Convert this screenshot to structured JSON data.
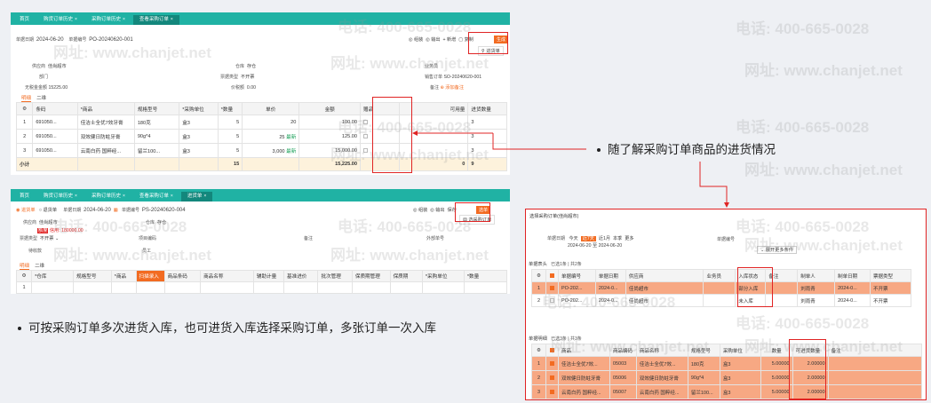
{
  "watermark": {
    "phone": "电话: 400-665-0028",
    "site": "网址: www.chanjet.net"
  },
  "top": {
    "tabs": [
      {
        "label": "首页"
      },
      {
        "label": "购货订单历史"
      },
      {
        "label": "采购订单历史"
      },
      {
        "label": "查看采购订单"
      }
    ],
    "doc_date_label": "单据日期",
    "doc_date": "2024-06-20",
    "doc_no_label": "单据编号",
    "doc_no": "PO-20240620-001",
    "toolbar": [
      "组装",
      "输出",
      "新增",
      "复制",
      "生成"
    ],
    "gen_menu": "进货单",
    "supplier_label": "供应商",
    "supplier": "佳尚超市",
    "dept_label": "部门",
    "dept": "",
    "pay_label": "无税金金额",
    "pay": "15225.00",
    "warehouse_label": "仓库",
    "warehouse": "存仓",
    "invoice_label": "票据类型",
    "invoice": "不开票",
    "tax_label": "价税额",
    "tax": "0.00",
    "staff_label": "业务员",
    "staff": "",
    "sales_no_label": "销售订单",
    "sales_no": "SO-20240620-001",
    "remark_label": "备注",
    "remark": "添加备注",
    "subtabs": [
      "明细",
      "二维"
    ],
    "table": {
      "headers": [
        "条码",
        "商品",
        "规格型号",
        "采购单位",
        "数量",
        "单价",
        "金额",
        "赠品",
        "可用量",
        "进货数量"
      ],
      "rows": [
        {
          "no": "1",
          "code": "691050...",
          "name": "佳洁士全优7效牙膏",
          "spec": "180克",
          "unit": "盒3",
          "qty": "5",
          "price": "20",
          "amount": "100.00",
          "avail": "",
          "inqty": "3"
        },
        {
          "no": "2",
          "code": "691050...",
          "name": "双效健日防蛀牙膏",
          "spec": "90g*4",
          "unit": "盒3",
          "qty": "5",
          "price": "25",
          "amount": "125.00",
          "avail": "",
          "inqty": "3"
        },
        {
          "no": "3",
          "code": "691050...",
          "name": "云南白药 国粹经...",
          "spec": "留兰100...",
          "unit": "盒3",
          "qty": "5",
          "price": "3,000",
          "amount": "15,000.00",
          "avail": "",
          "inqty": "3"
        }
      ],
      "badge": "最新",
      "sum_label": "小计",
      "sum_qty": "15",
      "sum_amount": "15,225.00",
      "sum_avail": "0",
      "sum_inqty": "9"
    }
  },
  "bottom": {
    "tabs": [
      {
        "label": "首页"
      },
      {
        "label": "购货订单历史"
      },
      {
        "label": "采购订单历史"
      },
      {
        "label": "查看采购订单"
      },
      {
        "label": "进货单"
      }
    ],
    "radio1": "进货单",
    "radio2": "退货单",
    "doc_date_label": "单据日期",
    "doc_date": "2024-06-20",
    "doc_no_label": "单据编号",
    "doc_no": "PS-20240620-004",
    "toolbar": [
      "组装",
      "输出",
      "保存",
      "选单"
    ],
    "menu": "选采购订单",
    "supplier_label": "供应商",
    "supplier": "佳尚超市",
    "credit": "信用: 180000.00",
    "invoice_label": "票据类型",
    "invoice": "不开票",
    "warehouse_label": "仓库",
    "warehouse": "存仓",
    "project_label": "项目编码",
    "project": "",
    "note_label": "备注",
    "note": "",
    "ref_label": "外部单号",
    "ref": "",
    "pay_label": "待收款",
    "pay": "",
    "staff_label": "员工",
    "staff": "",
    "subtabs": [
      "明细",
      "二维"
    ],
    "headers": [
      "仓库",
      "规格型号",
      "商品",
      "扫描录入",
      "商品条码",
      "商品名称",
      "辅助计量",
      "基准进价",
      "批次管理",
      "保质期管理",
      "保质期",
      "采购单位",
      "数量"
    ],
    "row_no": "1"
  },
  "modal": {
    "title": "选择采购订单(佳尚超市)",
    "date_label": "单据日期",
    "date_opts": [
      "今天",
      "近7天",
      "近1月",
      "本季",
      "更多"
    ],
    "date_range": "2024-06-20 至 2024-06-20",
    "doc_no_label": "单据编号",
    "search": "展开更多条件",
    "head_label": "单据表头",
    "selected": "已选1条 | 共2条",
    "head_headers": [
      "单据编号",
      "单据日期",
      "供应商",
      "业务员",
      "入库状态",
      "备注",
      "制单人",
      "制单日期",
      "票据类型"
    ],
    "head_rows": [
      {
        "no": "1",
        "code": "PO-202...",
        "date": "2024-0...",
        "supplier": "佳尚超市",
        "staff": "",
        "status": "部分入库",
        "remark": "",
        "maker": "刘雨青",
        "mdate": "2024-0...",
        "inv": "不开票"
      },
      {
        "no": "2",
        "code": "PO-202...",
        "date": "2024-0...",
        "supplier": "佳尚超市",
        "staff": "",
        "status": "未入库",
        "remark": "",
        "maker": "刘雨青",
        "mdate": "2024-0...",
        "inv": "不开票"
      }
    ],
    "detail_label": "单据明细",
    "detail_selected": "已选3条 | 共3条",
    "detail_headers": [
      "商品",
      "商品编码",
      "商品名称",
      "规格型号",
      "采购单位",
      "数量",
      "可进货数量",
      "备注"
    ],
    "detail_rows": [
      {
        "no": "1",
        "goods": "佳洁士全优7效...",
        "code": "05003",
        "name": "佳洁士全优7效...",
        "spec": "180克",
        "unit": "盒3",
        "qty": "5.00000",
        "avail": "2.00000"
      },
      {
        "no": "2",
        "goods": "双效健日防蛀牙膏",
        "code": "05006",
        "name": "双效健日防蛀牙膏",
        "spec": "90g*4",
        "unit": "盒3",
        "qty": "5.00000",
        "avail": "2.00000"
      },
      {
        "no": "3",
        "goods": "云南白药 国粹经...",
        "code": "05007",
        "name": "云南白药 国粹经...",
        "spec": "留兰100...",
        "unit": "盒3",
        "qty": "5.00000",
        "avail": "2.00000"
      }
    ]
  },
  "notes": {
    "right": "随了解采购订单商品的进货情况",
    "left": "可按采购订单多次进货入库，也可进货入库选择采购订单，多张订单一次入库"
  },
  "colors": {
    "teal": "#20b2a4",
    "orange": "#f26b21",
    "red": "#e02424"
  }
}
